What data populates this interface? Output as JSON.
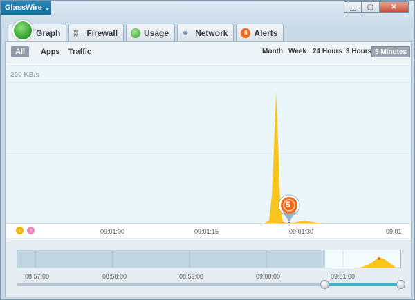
{
  "app": {
    "menu_label": "GlassWire"
  },
  "window_controls": {
    "minimize": "▁",
    "maximize": "▢",
    "close": "✕"
  },
  "tabs": [
    {
      "label": "Graph",
      "icon": "graph-icon",
      "active": true
    },
    {
      "label": "Firewall",
      "icon": "firewall-icon"
    },
    {
      "label": "Usage",
      "icon": "usage-icon"
    },
    {
      "label": "Network",
      "icon": "network-icon"
    },
    {
      "label": "Alerts",
      "icon": "alerts-icon",
      "badge": "6"
    }
  ],
  "filters": [
    "All",
    "Apps",
    "Traffic"
  ],
  "ranges": [
    "Month",
    "Week",
    "24 Hours",
    "3 Hours",
    "5 Minutes"
  ],
  "chart": {
    "ylabel": "200 KB/s",
    "ticks": [
      "09:01:00",
      "09:01:15",
      "09:01:30",
      "09:01"
    ],
    "alert_count": "5",
    "legend": {
      "download": "↓",
      "upload": "↑"
    }
  },
  "overview": {
    "labels": [
      "08:57:00",
      "08:58:00",
      "08:59:00",
      "09:00:00",
      "09:01:00"
    ]
  },
  "colors": {
    "accent": "#156d9b",
    "traffic": "#f7c51c",
    "alert": "#f06a18"
  }
}
